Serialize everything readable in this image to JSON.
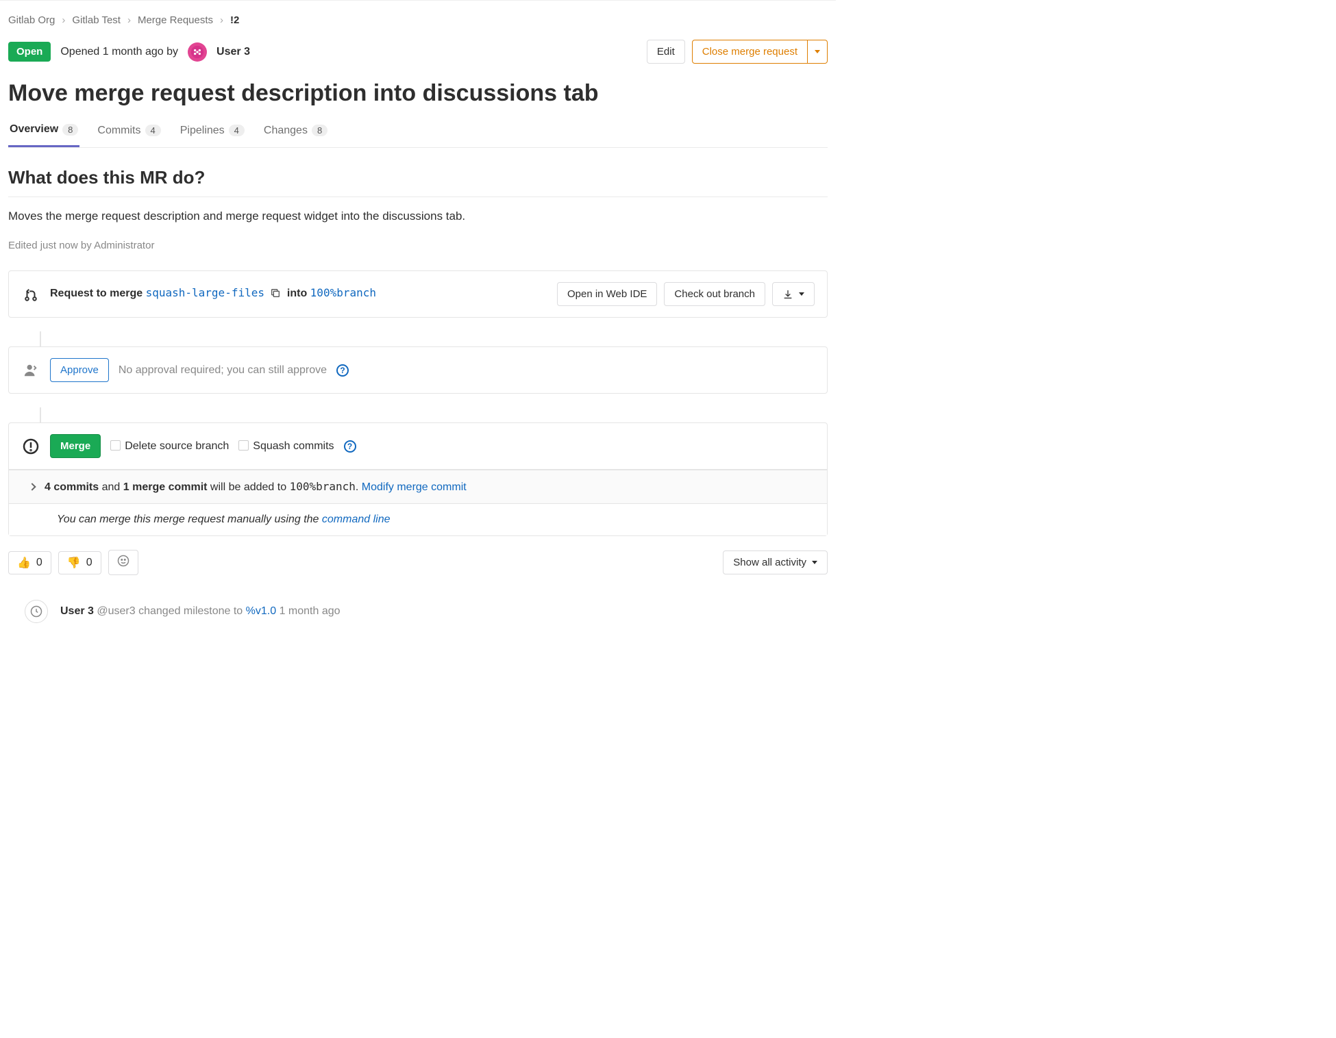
{
  "breadcrumb": {
    "org": "Gitlab Org",
    "project": "Gitlab Test",
    "section": "Merge Requests",
    "id": "!2"
  },
  "header": {
    "status": "Open",
    "opened_prefix": "Opened",
    "opened_time": "1 month ago",
    "by": "by",
    "author": "User 3",
    "edit_label": "Edit",
    "close_label": "Close merge request"
  },
  "title": "Move merge request description into discussions tab",
  "tabs": [
    {
      "label": "Overview",
      "count": "8",
      "active": true
    },
    {
      "label": "Commits",
      "count": "4",
      "active": false
    },
    {
      "label": "Pipelines",
      "count": "4",
      "active": false
    },
    {
      "label": "Changes",
      "count": "8",
      "active": false
    }
  ],
  "description": {
    "heading": "What does this MR do?",
    "body": "Moves the merge request description and merge request widget into the discussions tab.",
    "edited": "Edited just now by Administrator"
  },
  "merge_widget": {
    "request_label": "Request to merge",
    "source_branch": "squash-large-files",
    "into_label": "into",
    "target_branch": "100%branch",
    "open_ide": "Open in Web IDE",
    "checkout": "Check out branch"
  },
  "approval": {
    "approve_label": "Approve",
    "text": "No approval required; you can still approve"
  },
  "merge": {
    "button": "Merge",
    "delete_branch": "Delete source branch",
    "squash": "Squash commits",
    "commits_count": "4 commits",
    "and": "and",
    "merge_commit_count": "1 merge commit",
    "summary_tail": "will be added to",
    "summary_branch": "100%branch",
    "modify_link": "Modify merge commit",
    "manual_prefix": "You can merge this merge request manually using the",
    "cli_link": "command line"
  },
  "reactions": {
    "thumbs_up": "0",
    "thumbs_down": "0",
    "filter_label": "Show all activity"
  },
  "timeline": {
    "user_display": "User 3",
    "user_handle": "@user3",
    "action": "changed milestone to",
    "milestone": "%v1.0",
    "time": "1 month ago"
  }
}
